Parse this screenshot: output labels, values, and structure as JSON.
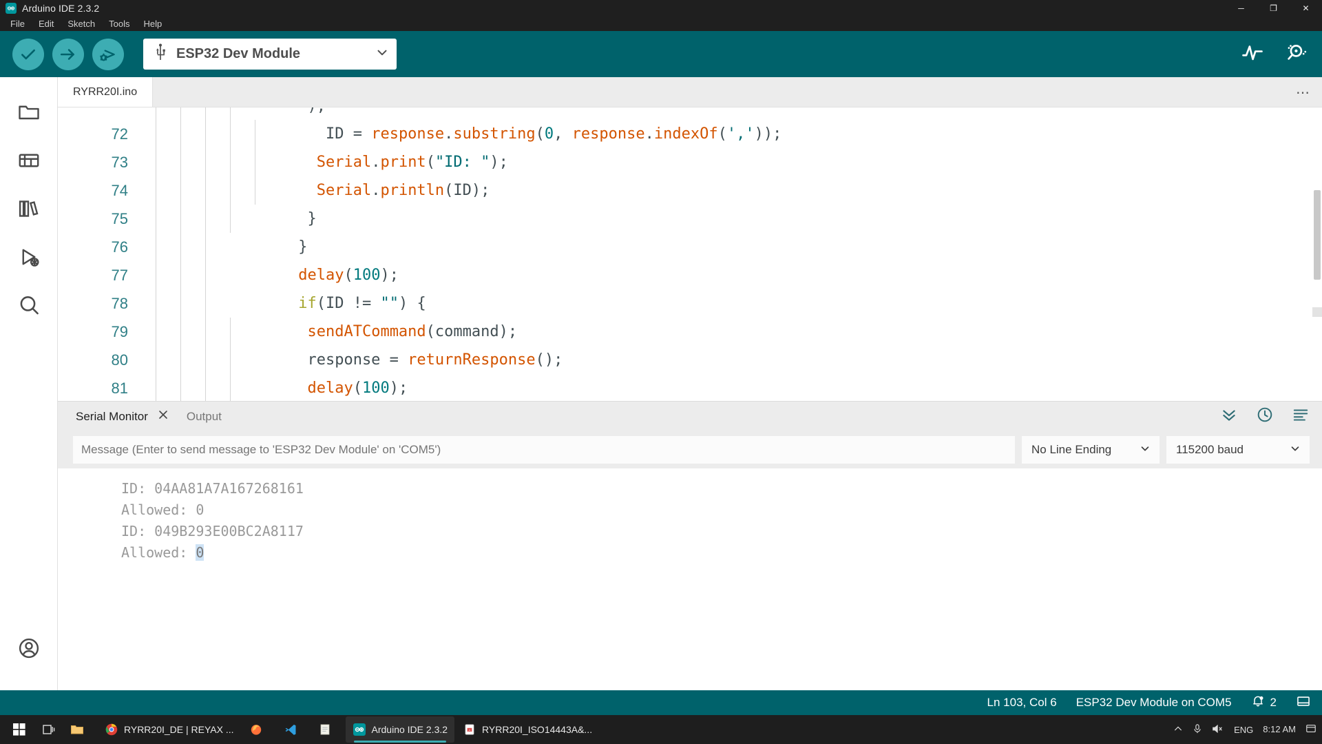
{
  "window": {
    "title": "Arduino IDE 2.3.2",
    "logo_icon": "arduino-logo-icon",
    "controls": {
      "minimize": "─",
      "maximize": "❐",
      "close": "✕"
    }
  },
  "menubar": {
    "items": [
      "File",
      "Edit",
      "Sketch",
      "Tools",
      "Help"
    ]
  },
  "toolbar": {
    "verify_icon": "checkmark-icon",
    "upload_icon": "arrow-right-icon",
    "debug_icon": "debug-bug-icon",
    "board_icon": "usb-icon",
    "board_label": "ESP32 Dev Module",
    "board_dropdown_icon": "chevron-down-icon",
    "plotter_icon": "serial-plotter-icon",
    "monitor_icon": "serial-monitor-icon"
  },
  "activitybar": {
    "items": [
      {
        "name": "sketchbook",
        "icon": "folder-icon"
      },
      {
        "name": "boards-manager",
        "icon": "boards-manager-icon"
      },
      {
        "name": "library-manager",
        "icon": "library-books-icon"
      },
      {
        "name": "debug",
        "icon": "debug-play-icon"
      },
      {
        "name": "search",
        "icon": "search-icon"
      }
    ],
    "account": {
      "name": "account",
      "icon": "account-circle-icon"
    }
  },
  "editor": {
    "tab_label": "RYRR20I.ino",
    "more_actions_icon": "ellipsis-icon",
    "partial_top_line": "      );",
    "lines": [
      {
        "num": "72",
        "indent": 5,
        "tokens": [
          {
            "t": "        ",
            "c": "plain"
          },
          {
            "t": "ID = ",
            "c": "plain"
          },
          {
            "t": "response",
            "c": "fn"
          },
          {
            "t": ".",
            "c": "plain"
          },
          {
            "t": "substring",
            "c": "fn"
          },
          {
            "t": "(",
            "c": "plain"
          },
          {
            "t": "0",
            "c": "num"
          },
          {
            "t": ", ",
            "c": "plain"
          },
          {
            "t": "response",
            "c": "fn"
          },
          {
            "t": ".",
            "c": "plain"
          },
          {
            "t": "indexOf",
            "c": "fn"
          },
          {
            "t": "(",
            "c": "plain"
          },
          {
            "t": "','",
            "c": "str"
          },
          {
            "t": "));",
            "c": "plain"
          }
        ]
      },
      {
        "num": "73",
        "indent": 5,
        "tokens": [
          {
            "t": "       ",
            "c": "plain"
          },
          {
            "t": "Serial",
            "c": "fn"
          },
          {
            "t": ".",
            "c": "plain"
          },
          {
            "t": "print",
            "c": "fn"
          },
          {
            "t": "(",
            "c": "plain"
          },
          {
            "t": "\"ID: \"",
            "c": "str"
          },
          {
            "t": ");",
            "c": "plain"
          }
        ]
      },
      {
        "num": "74",
        "indent": 5,
        "tokens": [
          {
            "t": "       ",
            "c": "plain"
          },
          {
            "t": "Serial",
            "c": "fn"
          },
          {
            "t": ".",
            "c": "plain"
          },
          {
            "t": "println",
            "c": "fn"
          },
          {
            "t": "(ID);",
            "c": "plain"
          }
        ]
      },
      {
        "num": "75",
        "indent": 4,
        "tokens": [
          {
            "t": "      }",
            "c": "plain"
          }
        ]
      },
      {
        "num": "76",
        "indent": 3,
        "tokens": [
          {
            "t": "     }",
            "c": "plain"
          }
        ]
      },
      {
        "num": "77",
        "indent": 3,
        "tokens": [
          {
            "t": "     ",
            "c": "plain"
          },
          {
            "t": "delay",
            "c": "fn"
          },
          {
            "t": "(",
            "c": "plain"
          },
          {
            "t": "100",
            "c": "num"
          },
          {
            "t": ");",
            "c": "plain"
          }
        ]
      },
      {
        "num": "78",
        "indent": 3,
        "tokens": [
          {
            "t": "     ",
            "c": "plain"
          },
          {
            "t": "if",
            "c": "kw"
          },
          {
            "t": "(ID != ",
            "c": "plain"
          },
          {
            "t": "\"\"",
            "c": "str"
          },
          {
            "t": ") {",
            "c": "plain"
          }
        ]
      },
      {
        "num": "79",
        "indent": 4,
        "tokens": [
          {
            "t": "      ",
            "c": "plain"
          },
          {
            "t": "sendATCommand",
            "c": "fn"
          },
          {
            "t": "(command);",
            "c": "plain"
          }
        ]
      },
      {
        "num": "80",
        "indent": 4,
        "tokens": [
          {
            "t": "      response = ",
            "c": "plain"
          },
          {
            "t": "returnResponse",
            "c": "fn"
          },
          {
            "t": "();",
            "c": "plain"
          }
        ]
      },
      {
        "num": "81",
        "indent": 4,
        "tokens": [
          {
            "t": "      ",
            "c": "plain"
          },
          {
            "t": "delay",
            "c": "fn"
          },
          {
            "t": "(",
            "c": "plain"
          },
          {
            "t": "100",
            "c": "num"
          },
          {
            "t": ");",
            "c": "plain"
          }
        ]
      }
    ]
  },
  "panel": {
    "tabs": [
      {
        "label": "Serial Monitor",
        "active": true,
        "close_icon": "close-icon"
      },
      {
        "label": "Output",
        "active": false
      }
    ],
    "tools": [
      {
        "name": "scroll-to-bottom",
        "icon": "chevrons-down-icon"
      },
      {
        "name": "toggle-timestamp",
        "icon": "clock-icon"
      },
      {
        "name": "clear-output",
        "icon": "lines-icon"
      }
    ],
    "serial_monitor": {
      "message_placeholder": "Message (Enter to send message to 'ESP32 Dev Module' on 'COM5')",
      "message_value": "",
      "line_ending": "No Line Ending",
      "baud_rate": "115200 baud",
      "dropdown_icon": "chevron-down-icon",
      "output_lines": [
        {
          "text": "ID: 04AA81A7A167268161",
          "selected": ""
        },
        {
          "text": "Allowed: 0",
          "selected": ""
        },
        {
          "text": "ID: 049B293E00BC2A8117",
          "selected": ""
        },
        {
          "text": "Allowed: ",
          "selected": "0"
        }
      ]
    }
  },
  "statusbar": {
    "cursor": "Ln 103, Col 6",
    "board_port": "ESP32 Dev Module on COM5",
    "notifications_icon": "bell-dot-icon",
    "notifications_count": "2",
    "panel_toggle_icon": "panel-layout-icon"
  },
  "taskbar": {
    "start_icon": "windows-start-icon",
    "taskview_icon": "task-view-icon",
    "items": [
      {
        "label": "",
        "icon": "file-explorer-icon",
        "active": false
      },
      {
        "label": "RYRR20I_DE | REYAX ...",
        "icon": "chrome-icon",
        "active": false
      },
      {
        "label": "",
        "icon": "firefox-icon",
        "active": false
      },
      {
        "label": "",
        "icon": "vscode-icon",
        "active": false
      },
      {
        "label": "",
        "icon": "notepad-icon",
        "active": false
      },
      {
        "label": "Arduino IDE 2.3.2",
        "icon": "arduino-icon",
        "active": true
      },
      {
        "label": "RYRR20I_ISO14443A&...",
        "icon": "pdf-icon",
        "active": false
      }
    ],
    "tray": {
      "overflow_icon": "chevron-up-icon",
      "mic_icon": "microphone-icon",
      "volume_icon": "speaker-mute-icon",
      "language": "ENG",
      "time": "8:12 AM",
      "notification_icon": "notification-icon"
    }
  },
  "colors": {
    "arduino_teal": "#00626b",
    "arduino_light_teal": "#3dadb3",
    "accent_orange": "#d35400",
    "line_number": "#2f7f86"
  }
}
